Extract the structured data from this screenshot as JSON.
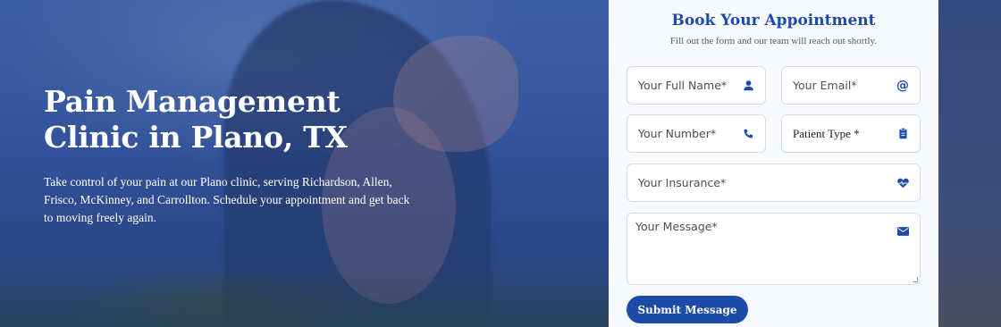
{
  "hero": {
    "title_line1": "Pain Management",
    "title_line2": "Clinic in Plano, TX",
    "description": "Take control of your pain at our Plano clinic, serving Richardson, Allen, Frisco, McKinney, and Carrollton. Schedule your appointment and get back to moving freely again."
  },
  "form": {
    "title": "Book Your Appointment",
    "subtitle": "Fill out the form and our team will reach out shortly.",
    "fields": {
      "name": {
        "placeholder": "Your Full Name*",
        "icon": "user-icon"
      },
      "email": {
        "placeholder": "Your Email*",
        "icon": "at-icon"
      },
      "number": {
        "placeholder": "Your Number*",
        "icon": "phone-icon"
      },
      "patient_type": {
        "value": "Patient Type *",
        "icon": "clipboard-icon"
      },
      "insurance": {
        "placeholder": "Your Insurance*",
        "icon": "heart-pulse-icon"
      },
      "message": {
        "placeholder": "Your Message*",
        "icon": "envelope-icon"
      }
    },
    "submit_label": "Submit Message"
  },
  "colors": {
    "accent": "#1c4ba8",
    "hero_overlay": "#33529a",
    "card_bg": "#f8f9fc"
  }
}
